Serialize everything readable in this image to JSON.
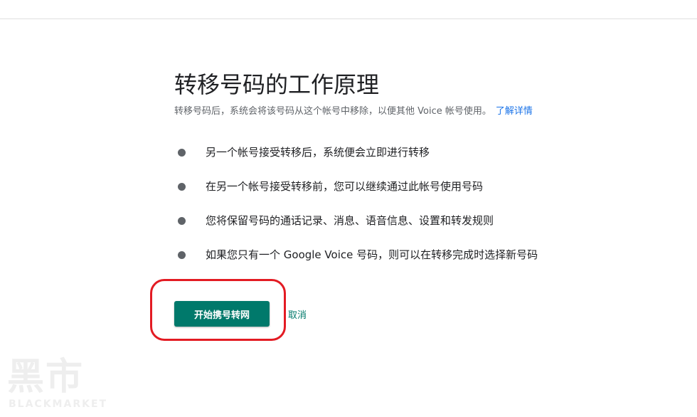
{
  "page": {
    "title": "转移号码的工作原理",
    "subtitle": "转移号码后，系统会将该号码从这个帐号中移除，以便其他 Voice 帐号使用。",
    "learn_more": "了解详情"
  },
  "bullets": [
    "另一个帐号接受转移后，系统便会立即进行转移",
    "在另一个帐号接受转移前，您可以继续通过此帐号使用号码",
    "您将保留号码的通话记录、消息、语音信息、设置和转发规则",
    "如果您只有一个 Google Voice 号码，则可以在转移完成时选择新号码"
  ],
  "actions": {
    "primary_label": "开始携号转网",
    "cancel_label": "取消"
  },
  "watermark": {
    "main": "黑市",
    "sub": "BLACKMARKET"
  },
  "colors": {
    "accent": "#00796b",
    "link": "#1a73e8",
    "highlight": "#e31b23"
  }
}
